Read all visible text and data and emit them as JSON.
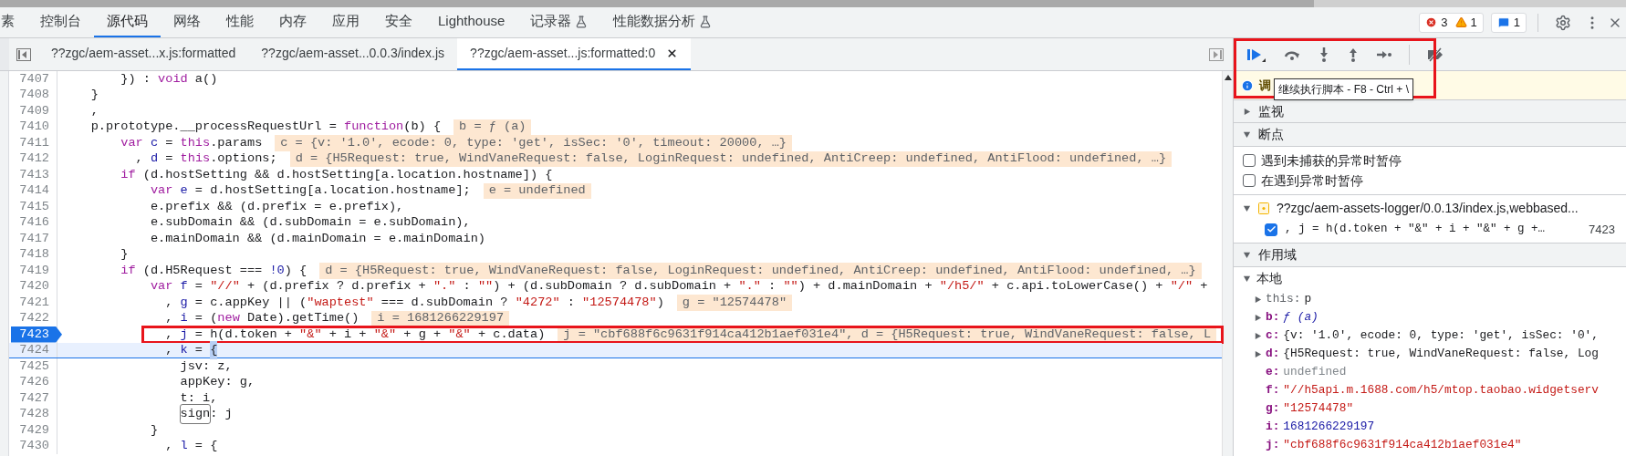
{
  "panel_tabs": [
    {
      "label": "素",
      "selected": false,
      "experimental": false
    },
    {
      "label": "控制台",
      "selected": false,
      "experimental": false
    },
    {
      "label": "源代码",
      "selected": true,
      "experimental": false
    },
    {
      "label": "网络",
      "selected": false,
      "experimental": false
    },
    {
      "label": "性能",
      "selected": false,
      "experimental": false
    },
    {
      "label": "内存",
      "selected": false,
      "experimental": false
    },
    {
      "label": "应用",
      "selected": false,
      "experimental": false
    },
    {
      "label": "安全",
      "selected": false,
      "experimental": false
    },
    {
      "label": "Lighthouse",
      "selected": false,
      "experimental": false
    },
    {
      "label": "记录器",
      "selected": false,
      "experimental": true
    },
    {
      "label": "性能数据分析",
      "selected": false,
      "experimental": true
    }
  ],
  "counters": {
    "errors": "3",
    "warnings": "1",
    "messages": "1"
  },
  "file_tabs": [
    {
      "label": "??zgc/aem-asset...x.js:formatted",
      "selected": false
    },
    {
      "label": "??zgc/aem-asset...0.0.3/index.js",
      "selected": false
    },
    {
      "label": "??zgc/aem-asset...js:formatted:0",
      "selected": true
    }
  ],
  "code_lines": [
    {
      "number": "7407",
      "breakpoint": false,
      "current": false,
      "tokens": [
        {
          "kind": "plain",
          "text": "        }) : "
        },
        {
          "kind": "kw",
          "text": "void"
        },
        {
          "kind": "plain",
          "text": " a()"
        }
      ]
    },
    {
      "number": "7408",
      "breakpoint": false,
      "current": false,
      "tokens": [
        {
          "kind": "plain",
          "text": "    }"
        }
      ]
    },
    {
      "number": "7409",
      "breakpoint": false,
      "current": false,
      "tokens": [
        {
          "kind": "plain",
          "text": "    ,"
        }
      ]
    },
    {
      "number": "7410",
      "breakpoint": false,
      "current": false,
      "tokens": [
        {
          "kind": "plain",
          "text": "    p.prototype.__processRequestUrl = "
        },
        {
          "kind": "kw",
          "text": "function"
        },
        {
          "kind": "plain",
          "text": "(b) {"
        }
      ],
      "value": "b = ƒ (a)"
    },
    {
      "number": "7411",
      "breakpoint": false,
      "current": false,
      "tokens": [
        {
          "kind": "kw",
          "text": "        var"
        },
        {
          "kind": "def",
          "text": " c"
        },
        {
          "kind": "plain",
          "text": " = "
        },
        {
          "kind": "kw",
          "text": "this"
        },
        {
          "kind": "plain",
          "text": ".params"
        }
      ],
      "value": "c = {v: '1.0', ecode: 0, type: 'get', isSec: '0', timeout: 20000, …}"
    },
    {
      "number": "7412",
      "breakpoint": false,
      "current": false,
      "tokens": [
        {
          "kind": "plain",
          "text": "          , "
        },
        {
          "kind": "def",
          "text": "d"
        },
        {
          "kind": "plain",
          "text": " = "
        },
        {
          "kind": "kw",
          "text": "this"
        },
        {
          "kind": "plain",
          "text": ".options;"
        }
      ],
      "value": "d = {H5Request: true, WindVaneRequest: false, LoginRequest: undefined, AntiCreep: undefined, AntiFlood: undefined, …}"
    },
    {
      "number": "7413",
      "breakpoint": false,
      "current": false,
      "tokens": [
        {
          "kind": "kw",
          "text": "        if"
        },
        {
          "kind": "plain",
          "text": " (d.hostSetting && d.hostSetting[a.location.hostname]) {"
        }
      ]
    },
    {
      "number": "7414",
      "breakpoint": false,
      "current": false,
      "tokens": [
        {
          "kind": "kw",
          "text": "            var"
        },
        {
          "kind": "def",
          "text": " e"
        },
        {
          "kind": "plain",
          "text": " = d.hostSetting[a.location.hostname];"
        }
      ],
      "value": "e = undefined"
    },
    {
      "number": "7415",
      "breakpoint": false,
      "current": false,
      "tokens": [
        {
          "kind": "plain",
          "text": "            e.prefix && (d.prefix = e.prefix),"
        }
      ]
    },
    {
      "number": "7416",
      "breakpoint": false,
      "current": false,
      "tokens": [
        {
          "kind": "plain",
          "text": "            e.subDomain && (d.subDomain = e.subDomain),"
        }
      ]
    },
    {
      "number": "7417",
      "breakpoint": false,
      "current": false,
      "tokens": [
        {
          "kind": "plain",
          "text": "            e.mainDomain && (d.mainDomain = e.mainDomain)"
        }
      ]
    },
    {
      "number": "7418",
      "breakpoint": false,
      "current": false,
      "tokens": [
        {
          "kind": "plain",
          "text": "        }"
        }
      ]
    },
    {
      "number": "7419",
      "breakpoint": false,
      "current": false,
      "tokens": [
        {
          "kind": "kw",
          "text": "        if"
        },
        {
          "kind": "plain",
          "text": " (d.H5Request === "
        },
        {
          "kind": "num",
          "text": "!0"
        },
        {
          "kind": "plain",
          "text": ") {"
        }
      ],
      "value": "d = {H5Request: true, WindVaneRequest: false, LoginRequest: undefined, AntiCreep: undefined, AntiFlood: undefined, …}"
    },
    {
      "number": "7420",
      "breakpoint": false,
      "current": false,
      "tokens": [
        {
          "kind": "kw",
          "text": "            var"
        },
        {
          "kind": "def",
          "text": " f"
        },
        {
          "kind": "plain",
          "text": " = "
        },
        {
          "kind": "str",
          "text": "\"//\""
        },
        {
          "kind": "plain",
          "text": " + (d.prefix ? d.prefix + "
        },
        {
          "kind": "str",
          "text": "\".\""
        },
        {
          "kind": "plain",
          "text": " : "
        },
        {
          "kind": "str",
          "text": "\"\""
        },
        {
          "kind": "plain",
          "text": ") + (d.subDomain ? d.subDomain + "
        },
        {
          "kind": "str",
          "text": "\".\""
        },
        {
          "kind": "plain",
          "text": " : "
        },
        {
          "kind": "str",
          "text": "\"\""
        },
        {
          "kind": "plain",
          "text": ") + d.mainDomain + "
        },
        {
          "kind": "str",
          "text": "\"/h5/\""
        },
        {
          "kind": "plain",
          "text": " + c.api.toLowerCase() + "
        },
        {
          "kind": "str",
          "text": "\"/\""
        },
        {
          "kind": "plain",
          "text": " +"
        }
      ]
    },
    {
      "number": "7421",
      "breakpoint": false,
      "current": false,
      "tokens": [
        {
          "kind": "plain",
          "text": "              , "
        },
        {
          "kind": "def",
          "text": "g"
        },
        {
          "kind": "plain",
          "text": " = c.appKey || ("
        },
        {
          "kind": "str",
          "text": "\"waptest\""
        },
        {
          "kind": "plain",
          "text": " === d.subDomain ? "
        },
        {
          "kind": "str",
          "text": "\"4272\""
        },
        {
          "kind": "plain",
          "text": " : "
        },
        {
          "kind": "str",
          "text": "\"12574478\""
        },
        {
          "kind": "plain",
          "text": ")"
        }
      ],
      "value": "g = \"12574478\""
    },
    {
      "number": "7422",
      "breakpoint": false,
      "current": false,
      "tokens": [
        {
          "kind": "plain",
          "text": "              , "
        },
        {
          "kind": "def",
          "text": "i"
        },
        {
          "kind": "plain",
          "text": " = ("
        },
        {
          "kind": "kw",
          "text": "new"
        },
        {
          "kind": "plain",
          "text": " Date).getTime()"
        }
      ],
      "value": "i = 1681266229197"
    },
    {
      "number": "7423",
      "breakpoint": true,
      "current": false,
      "tokens": [
        {
          "kind": "plain",
          "text": "              , "
        },
        {
          "kind": "def",
          "text": "j"
        },
        {
          "kind": "plain",
          "text": " = h(d.token + "
        },
        {
          "kind": "str",
          "text": "\"&\""
        },
        {
          "kind": "plain",
          "text": " + i + "
        },
        {
          "kind": "str",
          "text": "\"&\""
        },
        {
          "kind": "plain",
          "text": " + g + "
        },
        {
          "kind": "str",
          "text": "\"&\""
        },
        {
          "kind": "plain",
          "text": " + c.data)"
        }
      ],
      "value": "j = \"cbf688f6c9631f914ca412b1aef031e4\", d = {H5Request: true, WindVaneRequest: false, L"
    },
    {
      "number": "7424",
      "breakpoint": false,
      "current": true,
      "tokens": [
        {
          "kind": "plain",
          "text": "              , "
        },
        {
          "kind": "def",
          "text": "k"
        },
        {
          "kind": "plain",
          "text": " = "
        },
        {
          "kind": "match",
          "text": "{"
        }
      ]
    },
    {
      "number": "7425",
      "breakpoint": false,
      "current": false,
      "tokens": [
        {
          "kind": "plain",
          "text": "                jsv: z,"
        }
      ]
    },
    {
      "number": "7426",
      "breakpoint": false,
      "current": false,
      "tokens": [
        {
          "kind": "plain",
          "text": "                appKey: g,"
        }
      ]
    },
    {
      "number": "7427",
      "breakpoint": false,
      "current": false,
      "tokens": [
        {
          "kind": "plain",
          "text": "                t: i,"
        }
      ]
    },
    {
      "number": "7428",
      "breakpoint": false,
      "current": false,
      "tokens": [
        {
          "kind": "boxed",
          "text": "sign"
        },
        {
          "kind": "plain",
          "text": ": j"
        }
      ]
    },
    {
      "number": "7429",
      "breakpoint": false,
      "current": false,
      "tokens": [
        {
          "kind": "plain",
          "text": "            }"
        }
      ]
    },
    {
      "number": "7430",
      "breakpoint": false,
      "current": false,
      "tokens": [
        {
          "kind": "plain",
          "text": "              , "
        },
        {
          "kind": "def",
          "text": "l"
        },
        {
          "kind": "plain",
          "text": " = {"
        }
      ]
    }
  ],
  "debugger": {
    "tooltip": "继续执行脚本 - F8 - Ctrl + \\",
    "paused_banner": "调",
    "watch": {
      "title": "监视",
      "expanded": false
    },
    "breakpoints": {
      "title": "断点",
      "expanded": true,
      "options": [
        {
          "label": "遇到未捕获的异常时暂停",
          "checked": false
        },
        {
          "label": "在遇到异常时暂停",
          "checked": false
        }
      ],
      "files": [
        {
          "name": "??zgc/aem-assets-logger/0.0.13/index.js,webbased...",
          "expanded": true,
          "items": [
            {
              "code": ", j = h(d.token + \"&\" + i + \"&\" + g +…",
              "line": "7423",
              "checked": true
            }
          ]
        }
      ]
    },
    "scope": {
      "title": "作用域",
      "expanded": true,
      "groups": [
        {
          "title": "本地",
          "expanded": true,
          "vars": [
            {
              "name": "this:",
              "value": "p",
              "kind": "object",
              "expandable": true
            },
            {
              "name": "b:",
              "value": "ƒ (a)",
              "kind": "function",
              "expandable": true
            },
            {
              "name": "c:",
              "value": "{v: '1.0', ecode: 0, type: 'get', isSec: '0',",
              "kind": "object",
              "expandable": true
            },
            {
              "name": "d:",
              "value": "{H5Request: true, WindVaneRequest: false, Log",
              "kind": "object",
              "expandable": true
            },
            {
              "name": "e:",
              "value": "undefined",
              "kind": "undefined",
              "expandable": false
            },
            {
              "name": "f:",
              "value": "\"//h5api.m.1688.com/h5/mtop.taobao.widgetserv",
              "kind": "string",
              "expandable": false
            },
            {
              "name": "g:",
              "value": "\"12574478\"",
              "kind": "string",
              "expandable": false
            },
            {
              "name": "i:",
              "value": "1681266229197",
              "kind": "number",
              "expandable": false
            },
            {
              "name": "j:",
              "value": "\"cbf688f6c9631f914ca412b1aef031e4\"",
              "kind": "string",
              "expandable": false
            }
          ]
        }
      ]
    }
  }
}
